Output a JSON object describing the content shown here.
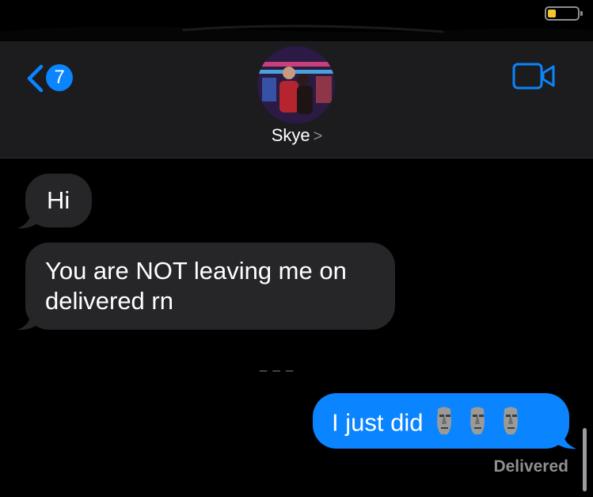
{
  "header": {
    "back_badge_count": "7",
    "contact_name": "Skye",
    "name_chevron": ">"
  },
  "messages": [
    {
      "direction": "incoming",
      "text": "Hi"
    },
    {
      "direction": "incoming",
      "text": "You are NOT leaving me on delivered rn"
    },
    {
      "direction": "outgoing",
      "text": "I just did",
      "emoji": [
        "moai",
        "moai",
        "moai"
      ]
    }
  ],
  "status": {
    "delivered": "Delivered"
  },
  "icons": {
    "back": "chevron-left-icon",
    "video": "video-camera-icon",
    "emoji": "moai-icon"
  },
  "colors": {
    "background": "#000000",
    "nav_bar": "#1c1c1e",
    "incoming_bubble": "#262628",
    "outgoing_bubble": "#0a84ff",
    "accent": "#0a84ff",
    "battery": "#f5c431"
  }
}
